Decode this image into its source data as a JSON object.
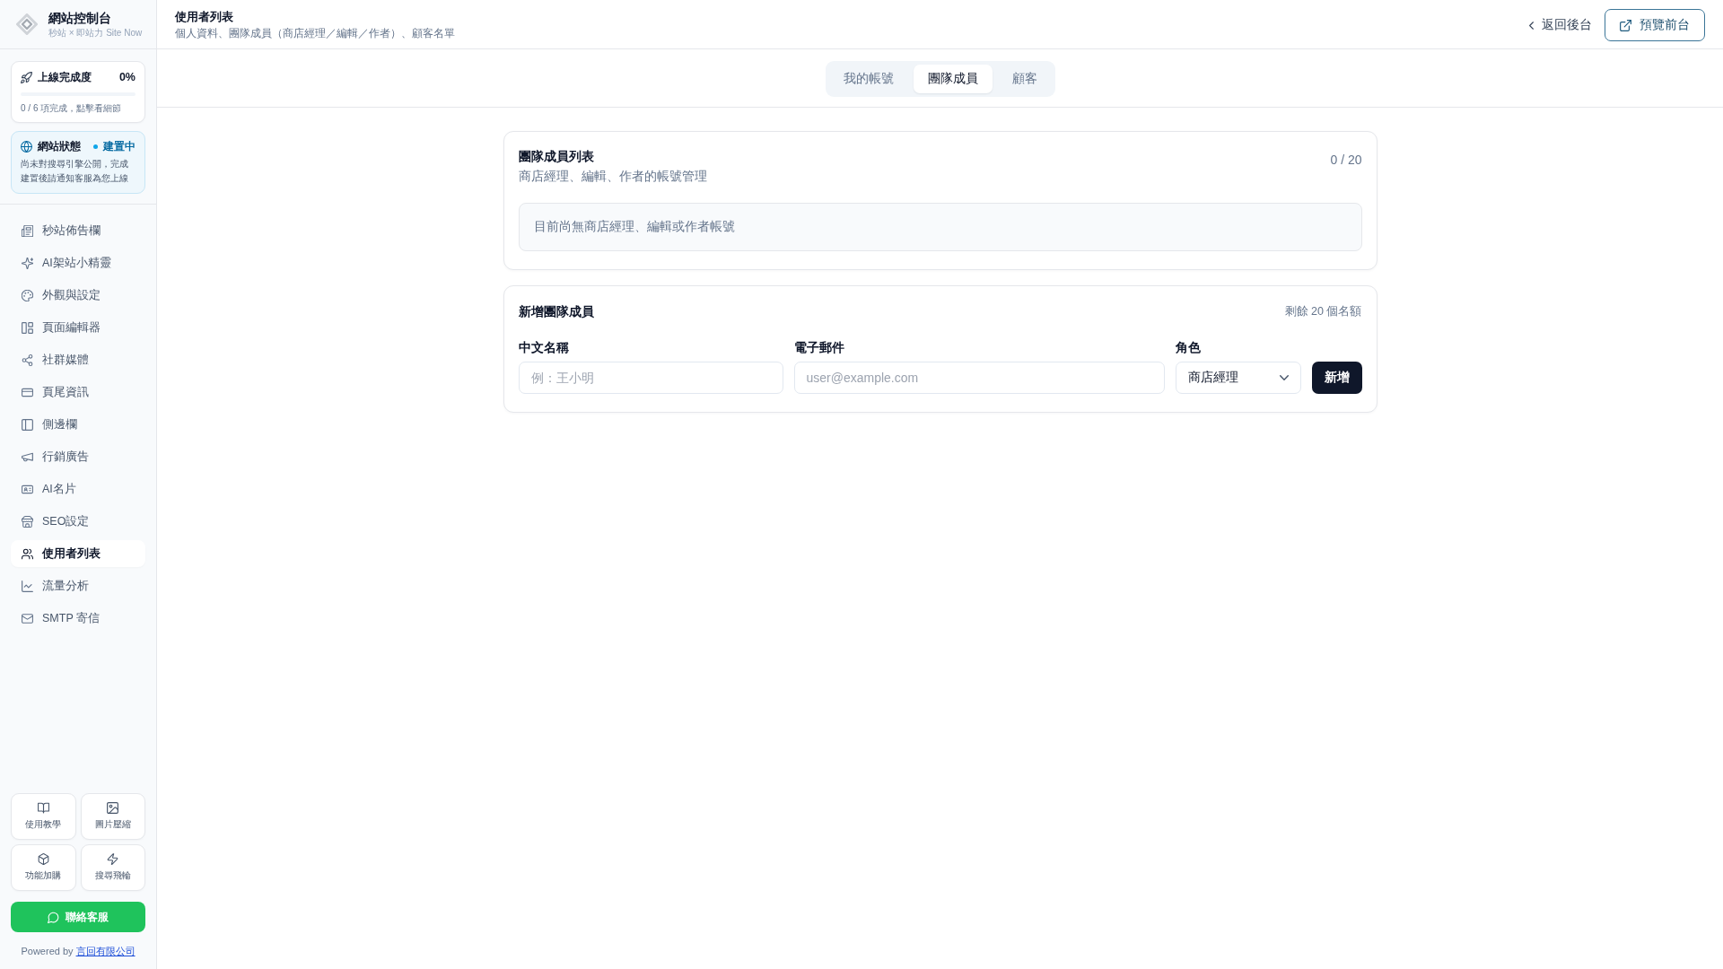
{
  "sidebar": {
    "brand": {
      "title": "網站控制台",
      "subtitle": "秒站 × 即站力 Site Now"
    },
    "progress_card": {
      "title": "上線完成度",
      "percent": "0%",
      "level": 0,
      "caption": "0 / 6 項完成，點擊看細節"
    },
    "status_card": {
      "title": "網站狀態",
      "status": "建置中",
      "description": "尚未對搜尋引擎公開，完成建置後請通知客服為您上線"
    },
    "nav_items": [
      {
        "label": "秒站佈告欄",
        "selected": false
      },
      {
        "label": "AI架站小精靈",
        "selected": false
      },
      {
        "label": "外觀與設定",
        "selected": false
      },
      {
        "label": "頁面編輯器",
        "selected": false
      },
      {
        "label": "社群媒體",
        "selected": false
      },
      {
        "label": "頁尾資訊",
        "selected": false
      },
      {
        "label": "側邊欄",
        "selected": false
      },
      {
        "label": "行銷廣告",
        "selected": false
      },
      {
        "label": "AI名片",
        "selected": false
      },
      {
        "label": "SEO設定",
        "selected": false
      },
      {
        "label": "使用者列表",
        "selected": true
      },
      {
        "label": "流量分析",
        "selected": false
      },
      {
        "label": "SMTP 寄信",
        "selected": false
      }
    ],
    "tools": [
      {
        "label": "使用教學"
      },
      {
        "label": "圖片壓縮"
      },
      {
        "label": "功能加購"
      },
      {
        "label": "搜尋飛輪"
      }
    ],
    "contact_button": "聯絡客服",
    "footer": {
      "text": "Powered by",
      "link": "言回有限公司"
    }
  },
  "header": {
    "title": "使用者列表",
    "subtitle": "個人資料、團隊成員（商店經理／編輯／作者）、顧客名單",
    "back_link": "返回後台",
    "preview_button": "預覽前台"
  },
  "tabs": [
    {
      "label": "我的帳號",
      "selected": false
    },
    {
      "label": "團隊成員",
      "selected": true
    },
    {
      "label": "顧客",
      "selected": false
    }
  ],
  "member_list": {
    "title": "團隊成員列表",
    "subtitle": "商店經理、編輯、作者的帳號管理",
    "count": "0 / 20",
    "empty_message": "目前尚無商店經理、編輯或作者帳號"
  },
  "add_member": {
    "title": "新增團隊成員",
    "quota": "剩餘 20 個名額",
    "fields": [
      {
        "kind": "input",
        "label": "中文名稱",
        "placeholder": "例：王小明"
      },
      {
        "kind": "input",
        "label": "電子郵件",
        "placeholder": "user@example.com"
      },
      {
        "kind": "select",
        "label": "角色",
        "value": "商店經理"
      }
    ],
    "submit_button": "新增"
  }
}
